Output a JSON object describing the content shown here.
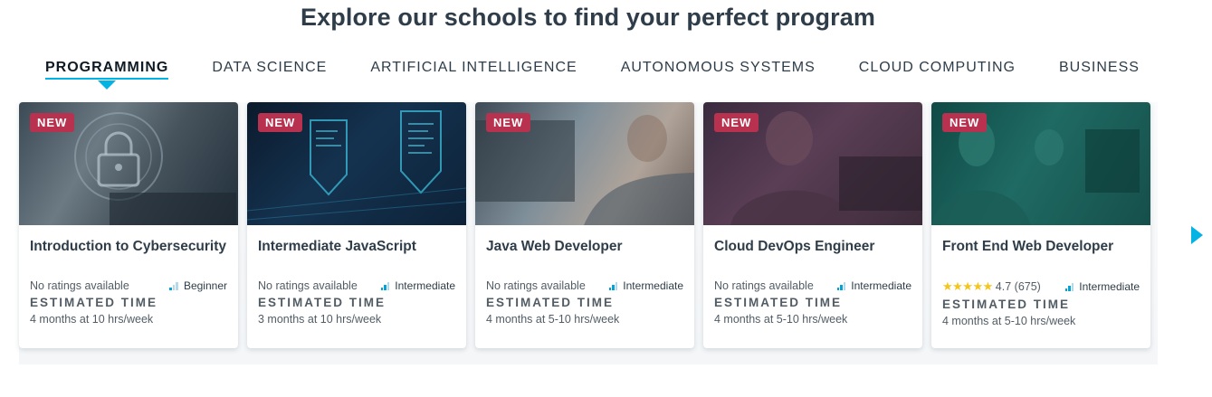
{
  "title": "Explore our schools to find your perfect program",
  "tabs": [
    {
      "label": "PROGRAMMING"
    },
    {
      "label": "DATA SCIENCE"
    },
    {
      "label": "ARTIFICIAL INTELLIGENCE"
    },
    {
      "label": "AUTONOMOUS SYSTEMS"
    },
    {
      "label": "CLOUD COMPUTING"
    },
    {
      "label": "BUSINESS"
    }
  ],
  "active_tab": "PROGRAMMING",
  "est_label": "ESTIMATED TIME",
  "colors": {
    "accent": "#02b3e4",
    "badge": "#b8324f",
    "star": "#f5c518"
  },
  "cards": [
    {
      "badge": "NEW",
      "title": "Introduction to Cybersecurity",
      "rating": "No ratings available",
      "level": "Beginner",
      "time": "4 months at 10 hrs/week",
      "image": "cybersecurity-lock-image"
    },
    {
      "badge": "NEW",
      "title": "Intermediate JavaScript",
      "rating": "No ratings available",
      "level": "Intermediate",
      "time": "3 months at 10 hrs/week",
      "image": "javascript-code-image"
    },
    {
      "badge": "NEW",
      "title": "Java Web Developer",
      "rating": "No ratings available",
      "level": "Intermediate",
      "time": "4 months at 5-10 hrs/week",
      "image": "developer-at-monitor-image"
    },
    {
      "badge": "NEW",
      "title": "Cloud DevOps Engineer",
      "rating": "No ratings available",
      "level": "Intermediate",
      "time": "4 months at 5-10 hrs/week",
      "image": "engineer-with-glasses-image"
    },
    {
      "badge": "NEW",
      "title": "Front End Web Developer",
      "rating_score": "4.7",
      "rating_count": "(675)",
      "stars": 4.7,
      "level": "Intermediate",
      "time": "4 months at 5-10 hrs/week",
      "image": "office-workers-image"
    }
  ]
}
